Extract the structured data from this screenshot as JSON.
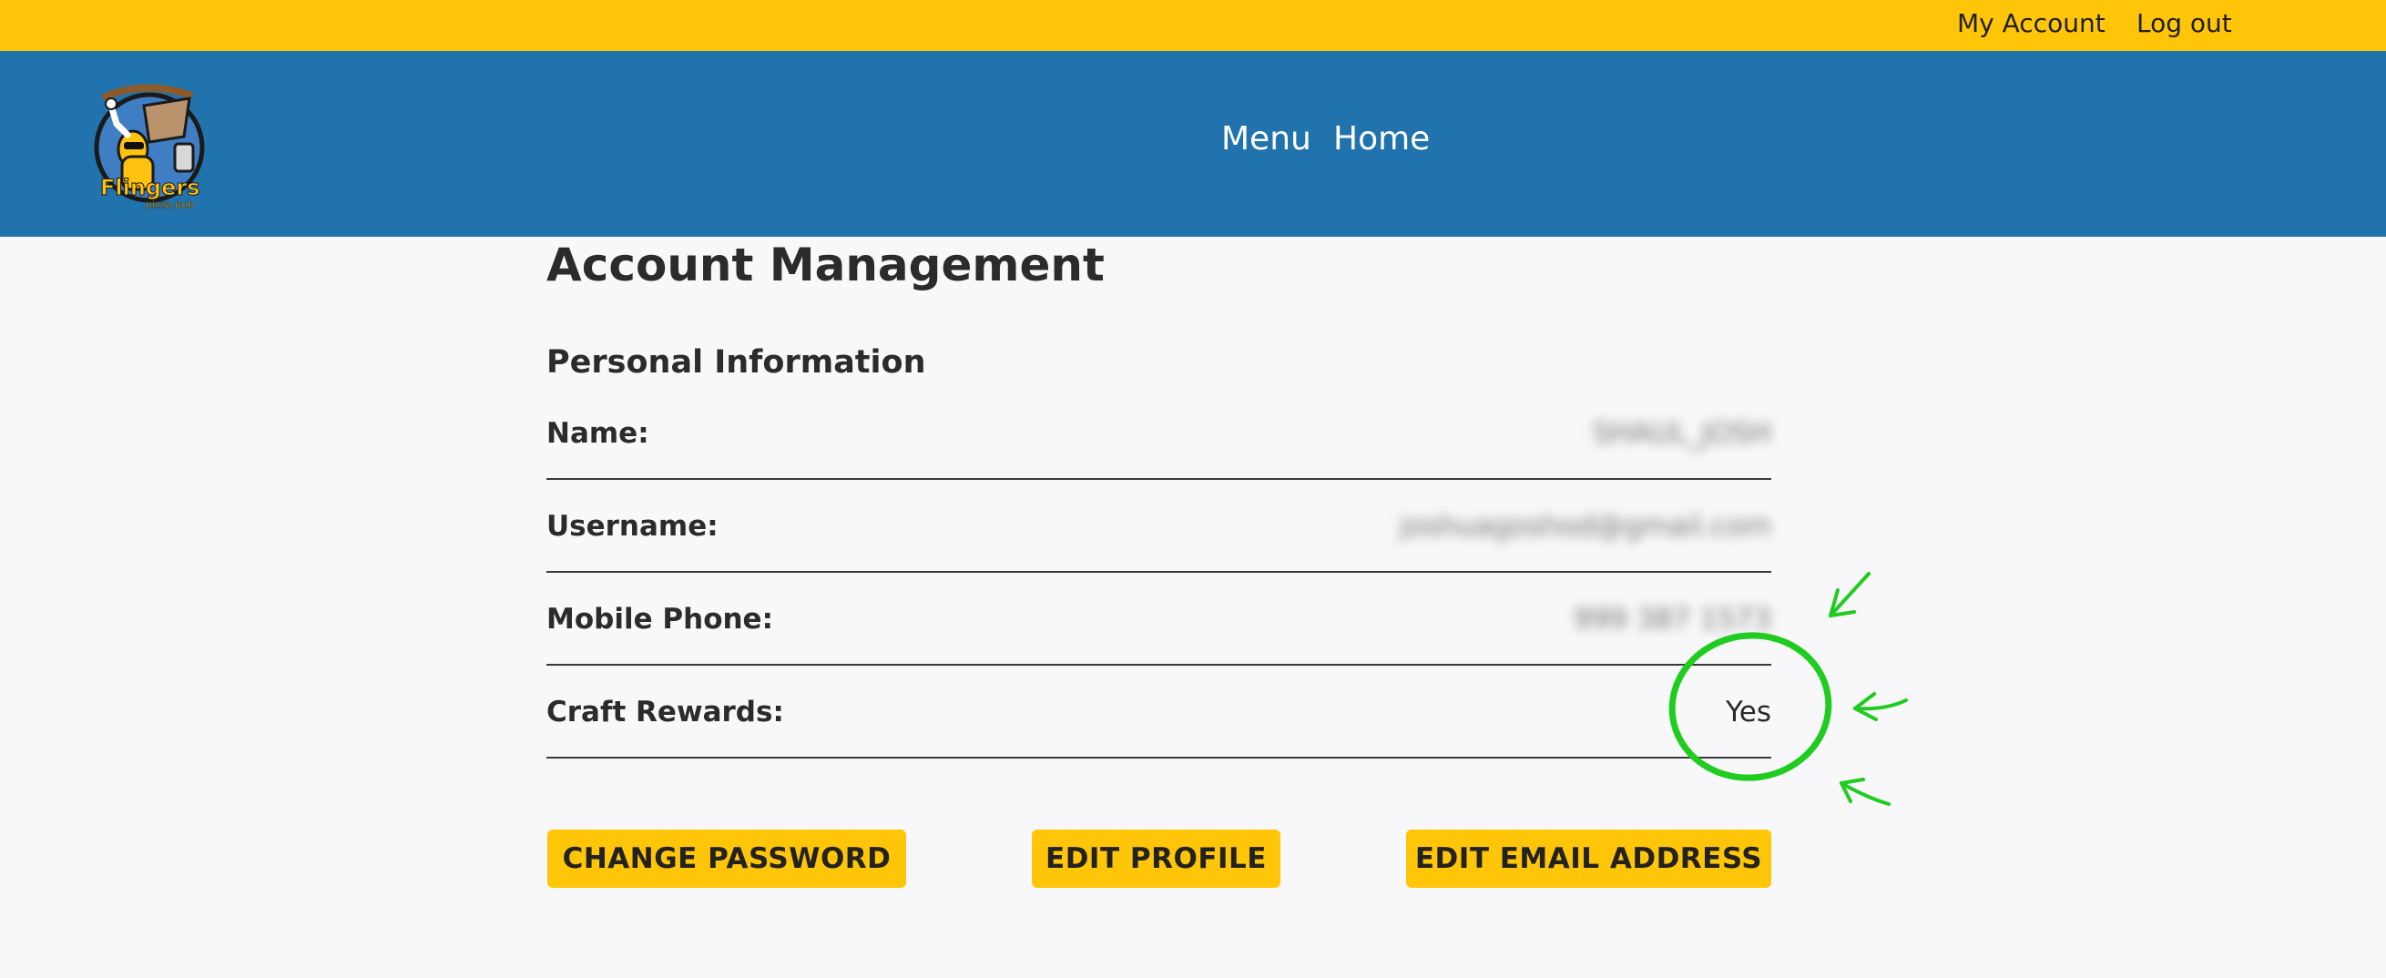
{
  "topbar": {
    "my_account": "My Account",
    "log_out": "Log out"
  },
  "header": {
    "logo_text": "Flingers",
    "nav": {
      "menu": "Menu",
      "home": "Home"
    }
  },
  "page": {
    "title": "Account Management",
    "section_title": "Personal Information"
  },
  "personal_info": {
    "name": {
      "label": "Name:",
      "value": "SHAUL_JOSH"
    },
    "username": {
      "label": "Username:",
      "value": "joshuagoshod@gmail.com"
    },
    "mobile_phone": {
      "label": "Mobile Phone:",
      "value": "999 387 1573"
    },
    "craft_rewards": {
      "label": "Craft Rewards:",
      "value": "Yes"
    }
  },
  "buttons": {
    "change_password": "CHANGE PASSWORD",
    "edit_profile": "EDIT PROFILE",
    "edit_email": "EDIT EMAIL ADDRESS"
  },
  "colors": {
    "topbar": "#ffc508",
    "header": "#2073ad",
    "background": "#f8f7f9",
    "button": "#ffc508",
    "annotation": "#1fcc1f"
  }
}
